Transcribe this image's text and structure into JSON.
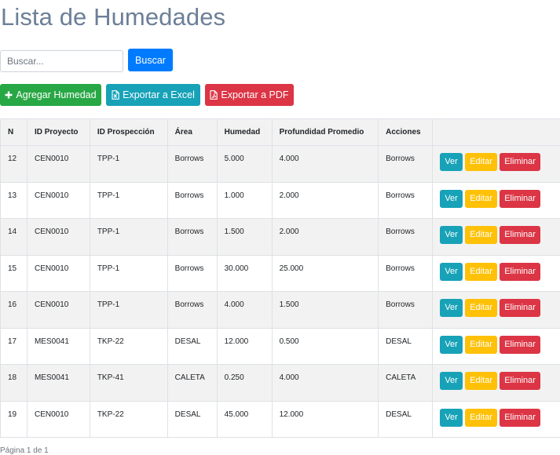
{
  "page": {
    "title": "Lista de Humedades"
  },
  "search": {
    "placeholder": "Buscar...",
    "value": "",
    "button_label": "Buscar"
  },
  "toolbar": {
    "add_label": "Agregar Humedad",
    "excel_label": "Exportar a Excel",
    "pdf_label": "Exportar a PDF"
  },
  "table": {
    "headers": [
      "N",
      "ID Proyecto",
      "ID Prospección",
      "Área",
      "Humedad",
      "Profundidad Promedio",
      "Acciones",
      ""
    ],
    "rows": [
      {
        "n": "12",
        "proyecto": "CEN0010",
        "prospeccion": "TPP-1",
        "area": "Borrows",
        "humedad": "5.000",
        "profundidad": "4.000",
        "acciones": "Borrows"
      },
      {
        "n": "13",
        "proyecto": "CEN0010",
        "prospeccion": "TPP-1",
        "area": "Borrows",
        "humedad": "1.000",
        "profundidad": "2.000",
        "acciones": "Borrows"
      },
      {
        "n": "14",
        "proyecto": "CEN0010",
        "prospeccion": "TPP-1",
        "area": "Borrows",
        "humedad": "1.500",
        "profundidad": "2.000",
        "acciones": "Borrows"
      },
      {
        "n": "15",
        "proyecto": "CEN0010",
        "prospeccion": "TPP-1",
        "area": "Borrows",
        "humedad": "30.000",
        "profundidad": "25.000",
        "acciones": "Borrows"
      },
      {
        "n": "16",
        "proyecto": "CEN0010",
        "prospeccion": "TPP-1",
        "area": "Borrows",
        "humedad": "4.000",
        "profundidad": "1.500",
        "acciones": "Borrows"
      },
      {
        "n": "17",
        "proyecto": "MES0041",
        "prospeccion": "TKP-22",
        "area": "DESAL",
        "humedad": "12.000",
        "profundidad": "0.500",
        "acciones": "DESAL"
      },
      {
        "n": "18",
        "proyecto": "MES0041",
        "prospeccion": "TKP-41",
        "area": "CALETA",
        "humedad": "0.250",
        "profundidad": "4.000",
        "acciones": "CALETA"
      },
      {
        "n": "19",
        "proyecto": "CEN0010",
        "prospeccion": "TKP-22",
        "area": "DESAL",
        "humedad": "45.000",
        "profundidad": "12.000",
        "acciones": "DESAL"
      }
    ],
    "action_labels": {
      "view": "Ver",
      "edit": "Editar",
      "delete": "Eliminar"
    }
  },
  "pagination": {
    "text": "Página 1 de 1"
  },
  "colors": {
    "primary": "#007bff",
    "success": "#28a745",
    "info": "#17a2b8",
    "danger": "#dc3545",
    "warning": "#ffc107",
    "title": "#6c7f98"
  },
  "icons": {
    "add": "plus-icon",
    "excel": "file-excel-icon",
    "pdf": "file-pdf-icon"
  }
}
